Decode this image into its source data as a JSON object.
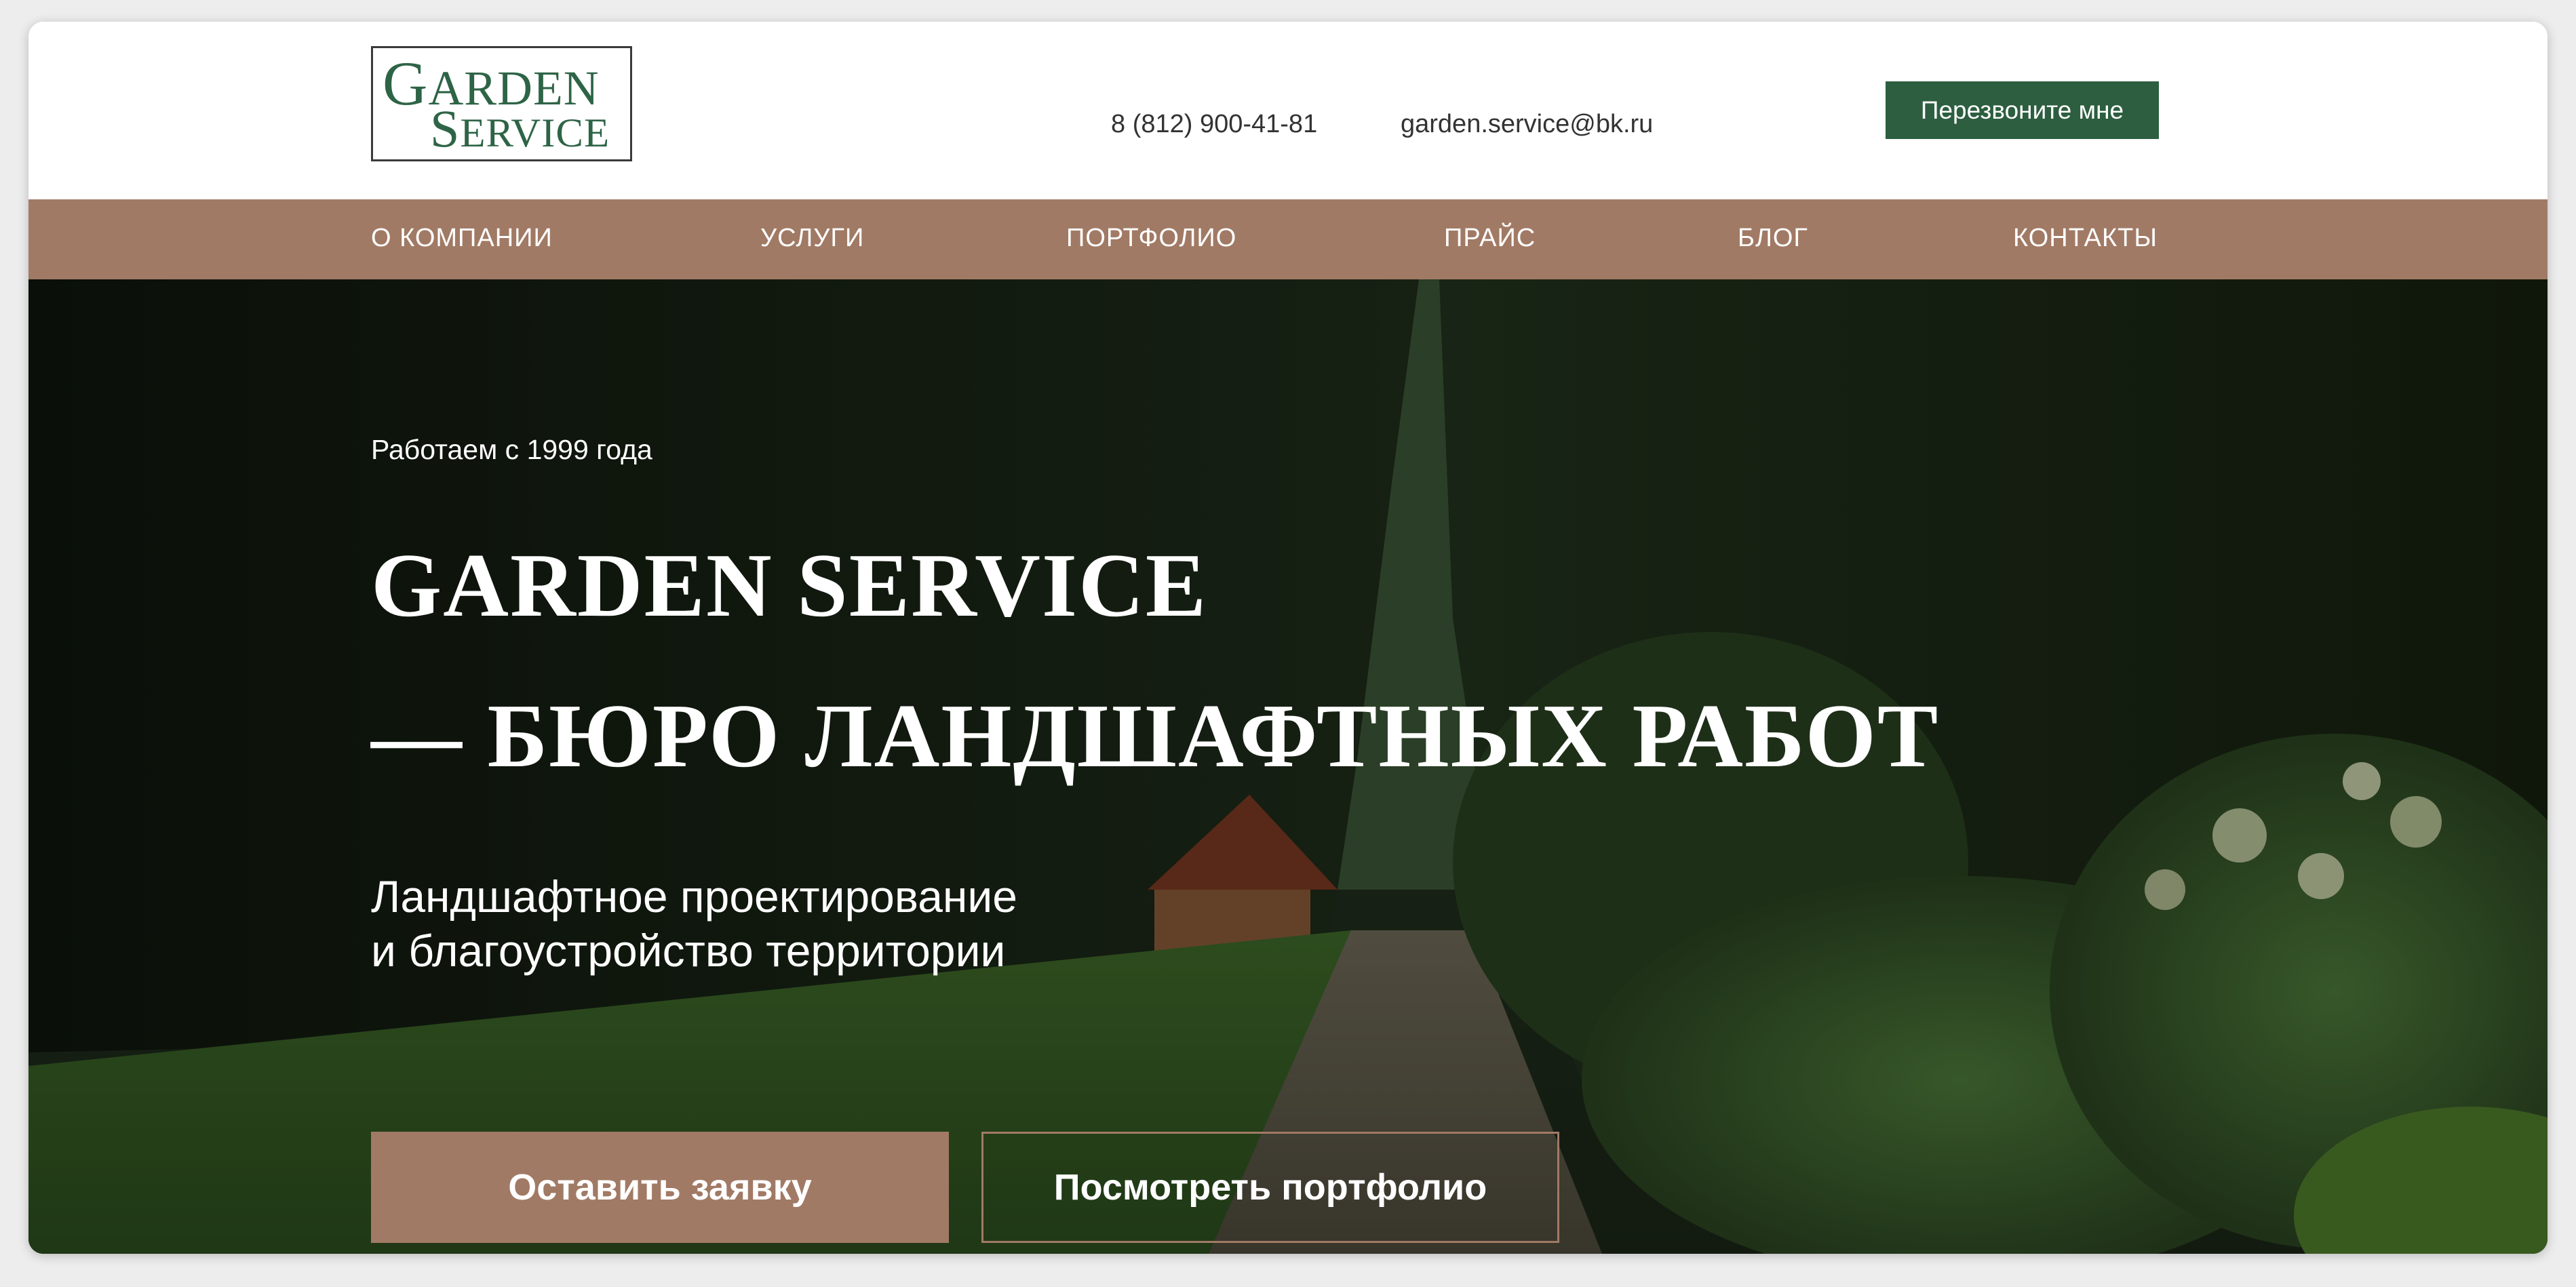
{
  "header": {
    "logo": {
      "line1": "GARDEN",
      "line2": "SERVICE"
    },
    "phone": "8 (812) 900-41-81",
    "email": "garden.service@bk.ru",
    "callback_label": "Перезвоните мне"
  },
  "nav": {
    "items": [
      {
        "label": "О КОМПАНИИ"
      },
      {
        "label": "УСЛУГИ"
      },
      {
        "label": "ПОРТФОЛИО"
      },
      {
        "label": "ПРАЙС"
      },
      {
        "label": "БЛОГ"
      },
      {
        "label": "КОНТАКТЫ"
      }
    ]
  },
  "hero": {
    "since": "Работаем с 1999 года",
    "title_line1": "GARDEN SERVICE",
    "title_line2": "— БЮРО ЛАНДШАФТНЫХ РАБОТ",
    "subtitle_line1": "Ландшафтное проектирование",
    "subtitle_line2": "и благоустройство территории",
    "request_label": "Оставить заявку",
    "portfolio_label": "Посмотреть портфолио"
  },
  "colors": {
    "accent_brown": "#a17a65",
    "brand_green": "#2c5e3f",
    "logo_green": "#2e6446"
  }
}
